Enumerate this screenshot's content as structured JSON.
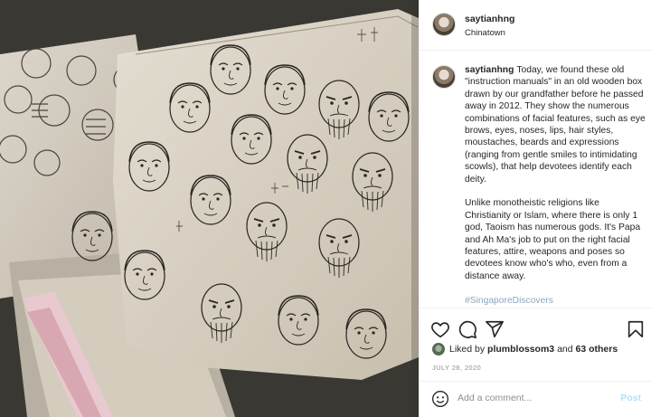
{
  "post": {
    "username": "saytianhng",
    "location": "Chinatown",
    "caption_author": "saytianhng",
    "caption_p1": "Today, we found these old \"instruction manuals\" in an old wooden box drawn by our grandfather before he passed away in 2012. They show the numerous combinations of facial features, such as eye brows, eyes, noses, lips, hair styles, moustaches, beards and expressions (ranging from gentle smiles to intimidating scowls), that help devotees identify each deity.",
    "caption_p2": "Unlike monotheistic religions like Christianity or Islam, where there is only 1 god, Taoism has numerous gods. It's Papa and Ah Ma's job to put on the right facial features, attire, weapons and poses so devotees know who's who, even from a distance away.",
    "hashtag": "#SingaporeDiscovers",
    "likes_prefix": "Liked by",
    "liked_by_user": "plumblossom3",
    "likes_and": "and",
    "likes_others": "63 others",
    "date": "JULY 28, 2020",
    "comment_placeholder": "Add a comment...",
    "post_button": "Post"
  },
  "icons": {
    "like": "heart-icon",
    "comment": "comment-icon",
    "share": "paper-plane-icon",
    "save": "bookmark-icon",
    "emoji": "smiley-icon"
  },
  "colors": {
    "link": "#00376b",
    "post_button": "#b2dffc",
    "muted": "#8e8e8e"
  }
}
